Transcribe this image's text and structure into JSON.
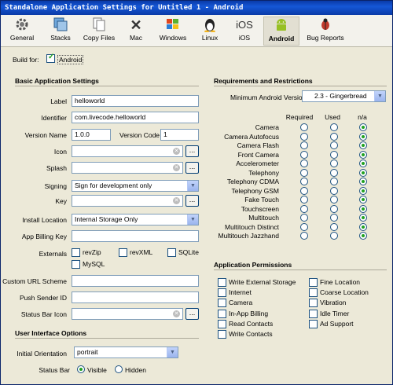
{
  "window": {
    "title": "Standalone Application Settings for Untitled 1 - Android"
  },
  "toolbar": [
    {
      "label": "General",
      "icon": "gear-icon"
    },
    {
      "label": "Stacks",
      "icon": "stacks-icon"
    },
    {
      "label": "Copy Files",
      "icon": "copy-files-icon"
    },
    {
      "label": "Mac",
      "icon": "mac-icon"
    },
    {
      "label": "Windows",
      "icon": "windows-icon"
    },
    {
      "label": "Linux",
      "icon": "linux-icon"
    },
    {
      "label": "iOS",
      "icon": "ios-icon",
      "icon_text": "iOS"
    },
    {
      "label": "Android",
      "icon": "android-icon",
      "active": true
    },
    {
      "label": "Bug Reports",
      "icon": "bug-icon"
    }
  ],
  "build_for": {
    "label": "Build for:",
    "option": "Android",
    "checked": true
  },
  "basic": {
    "heading": "Basic Application Settings",
    "label_label": "Label",
    "label_value": "helloworld",
    "identifier_label": "Identifier",
    "identifier_value": "com.livecode.helloworld",
    "version_name_label": "Version Name",
    "version_name_value": "1.0.0",
    "version_code_label": "Version Code",
    "version_code_value": "1",
    "icon_label": "Icon",
    "splash_label": "Splash",
    "browse_label": "...",
    "signing_label": "Signing",
    "signing_value": "Sign for development only",
    "key_label": "Key",
    "install_location_label": "Install Location",
    "install_location_value": "Internal Storage Only",
    "billing_key_label": "App Billing Key",
    "externals_label": "Externals",
    "externals": [
      {
        "label": "revZip",
        "checked": false
      },
      {
        "label": "revXML",
        "checked": false
      },
      {
        "label": "SQLite",
        "checked": false
      },
      {
        "label": "MySQL",
        "checked": false
      }
    ],
    "custom_url_label": "Custom URL Scheme",
    "push_sender_label": "Push Sender ID",
    "status_bar_icon_label": "Status Bar Icon"
  },
  "ui_options": {
    "heading": "User Interface Options",
    "orientation_label": "Initial Orientation",
    "orientation_value": "portrait",
    "status_bar_label": "Status Bar",
    "visible_label": "Visible",
    "hidden_label": "Hidden",
    "status_bar_value": "Visible"
  },
  "requirements": {
    "heading": "Requirements and Restrictions",
    "min_version_label": "Minimum Android Version",
    "min_version_value": "2.3 - Gingerbread",
    "columns": [
      "Required",
      "Used",
      "n/a"
    ],
    "rows": [
      {
        "label": "Camera",
        "value": "n/a"
      },
      {
        "label": "Camera Autofocus",
        "value": "n/a"
      },
      {
        "label": "Camera Flash",
        "value": "n/a"
      },
      {
        "label": "Front Camera",
        "value": "n/a"
      },
      {
        "label": "Accelerometer",
        "value": "n/a"
      },
      {
        "label": "Telephony",
        "value": "n/a"
      },
      {
        "label": "Telephony CDMA",
        "value": "n/a"
      },
      {
        "label": "Telephony GSM",
        "value": "n/a"
      },
      {
        "label": "Fake Touch",
        "value": "n/a"
      },
      {
        "label": "Touchscreen",
        "value": "n/a"
      },
      {
        "label": "Multitouch",
        "value": "n/a"
      },
      {
        "label": "Multitouch Distinct",
        "value": "n/a"
      },
      {
        "label": "Multitouch Jazzhand",
        "value": "n/a"
      }
    ]
  },
  "permissions": {
    "heading": "Application Permissions",
    "left": [
      {
        "label": "Write External Storage",
        "checked": false
      },
      {
        "label": "Internet",
        "checked": false
      },
      {
        "label": "Camera",
        "checked": false
      },
      {
        "label": "In-App Billing",
        "checked": false
      },
      {
        "label": "Read Contacts",
        "checked": false
      },
      {
        "label": "Write Contacts",
        "checked": false
      }
    ],
    "right": [
      {
        "label": "Fine Location",
        "checked": false
      },
      {
        "label": "Coarse Location",
        "checked": false
      },
      {
        "label": "Vibration",
        "checked": false
      },
      {
        "label": "Idle Timer",
        "checked": false
      },
      {
        "label": "Ad Support",
        "checked": false
      }
    ]
  },
  "colors": {
    "accent": "#21a121",
    "title_bar": "#0a3aa8"
  }
}
